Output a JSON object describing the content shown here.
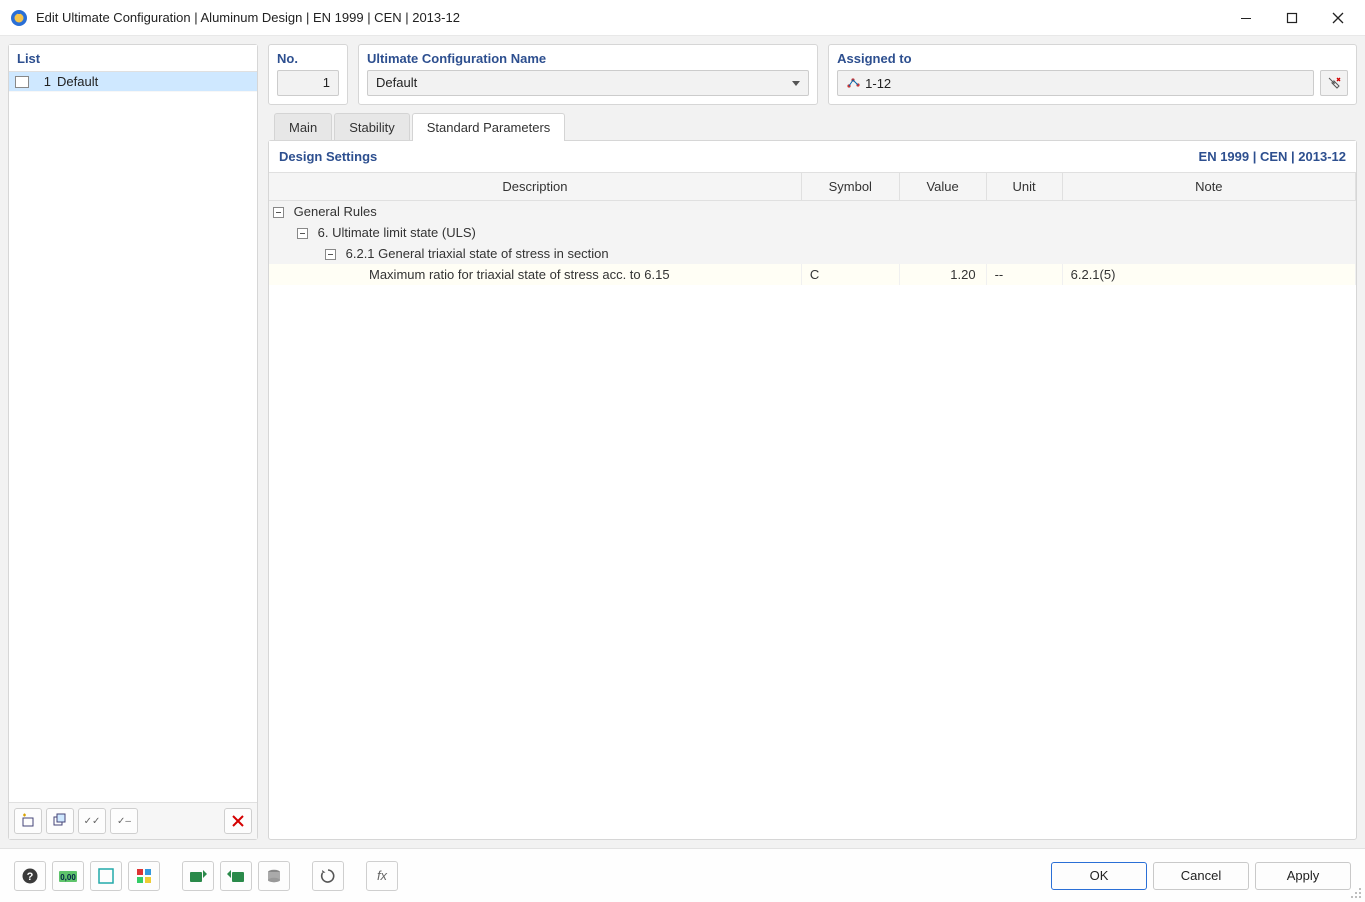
{
  "window": {
    "title": "Edit Ultimate Configuration | Aluminum Design | EN 1999 | CEN | 2013-12"
  },
  "list": {
    "header": "List",
    "items": [
      {
        "num": "1",
        "name": "Default"
      }
    ]
  },
  "fields": {
    "no_label": "No.",
    "no_value": "1",
    "name_label": "Ultimate Configuration Name",
    "name_value": "Default",
    "assigned_label": "Assigned to",
    "assigned_value": "1-12"
  },
  "tabs": {
    "main": "Main",
    "stability": "Stability",
    "std_params": "Standard Parameters"
  },
  "section": {
    "title": "Design Settings",
    "standard": "EN 1999 | CEN | 2013-12"
  },
  "columns": {
    "description": "Description",
    "symbol": "Symbol",
    "value": "Value",
    "unit": "Unit",
    "note": "Note"
  },
  "tree": {
    "node0": "General Rules",
    "node1": "6. Ultimate limit state (ULS)",
    "node2": "6.2.1 General triaxial state of stress in section",
    "row": {
      "desc": "Maximum ratio for triaxial state of stress acc. to 6.15",
      "symbol": "C",
      "value": "1.20",
      "unit": "--",
      "note": "6.2.1(5)"
    }
  },
  "buttons": {
    "ok": "OK",
    "cancel": "Cancel",
    "apply": "Apply"
  }
}
